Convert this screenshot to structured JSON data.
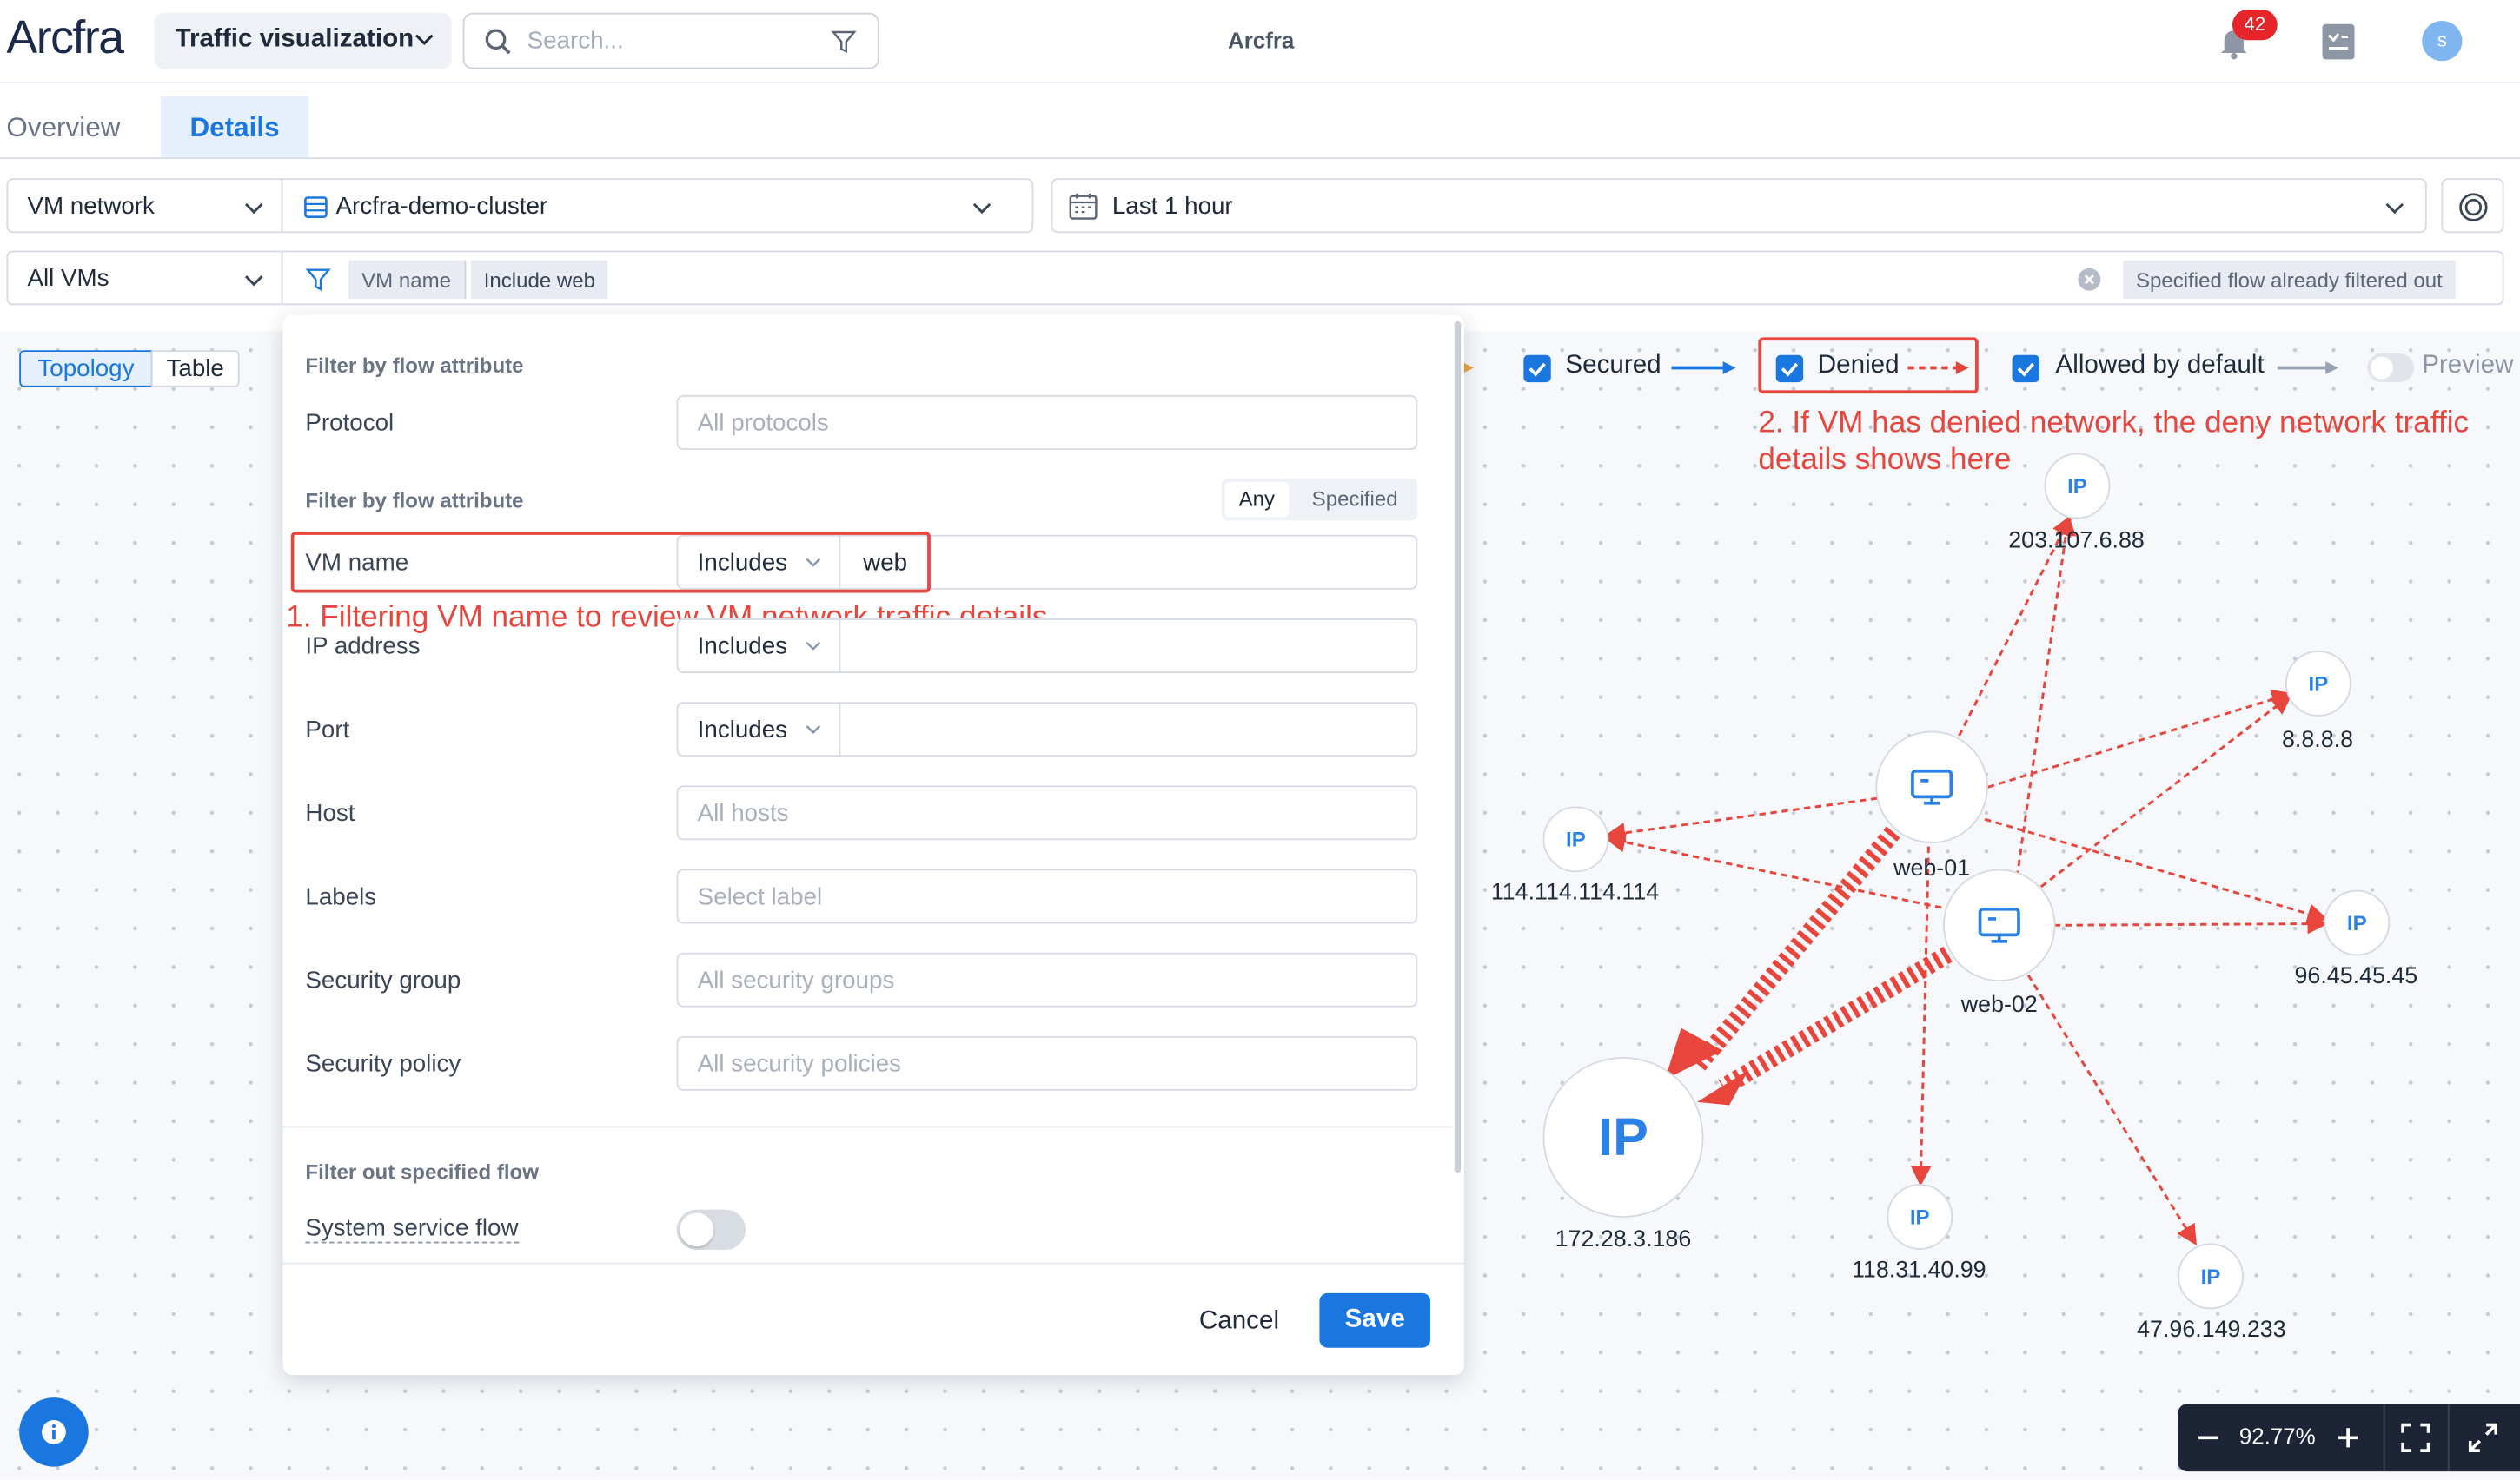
{
  "header": {
    "logo": "Arcfra",
    "app_selector": "Traffic visualization",
    "search_placeholder": "Search...",
    "center_title": "Arcfra",
    "notification_count": "42",
    "avatar_initial": "s"
  },
  "tabs": [
    {
      "label": "Overview",
      "active": false
    },
    {
      "label": "Details",
      "active": true
    }
  ],
  "filters": {
    "view_type": "VM network",
    "cluster": "Arcfra-demo-cluster",
    "time_range": "Last 1 hour",
    "vm_scope": "All VMs",
    "chip_key": "VM name",
    "chip_value": "Include web",
    "filtered_notice": "Specified flow already filtered out"
  },
  "view_toggle": {
    "topology": "Topology",
    "table": "Table"
  },
  "legend": {
    "secured": "Secured",
    "denied": "Denied",
    "allowed_by_default": "Allowed by default",
    "preview": "Preview"
  },
  "annotations": {
    "step1": "1. Filtering VM name to review VM network traffic details",
    "step2_line1": "2. If VM has denied network, the deny network traffic",
    "step2_line2": "details shows here"
  },
  "filter_panel": {
    "section1_title": "Filter by flow attribute",
    "protocol_label": "Protocol",
    "protocol_placeholder": "All protocols",
    "section2_title": "Filter by flow attribute",
    "match_any": "Any",
    "match_specified": "Specified",
    "vm_name_label": "VM name",
    "vm_name_op": "Includes",
    "vm_name_value": "web",
    "ip_label": "IP address",
    "ip_op": "Includes",
    "port_label": "Port",
    "port_op": "Includes",
    "host_label": "Host",
    "host_placeholder": "All hosts",
    "labels_label": "Labels",
    "labels_placeholder": "Select label",
    "sg_label": "Security group",
    "sg_placeholder": "All security groups",
    "sp_label": "Security policy",
    "sp_placeholder": "All security policies",
    "section3_title": "Filter out specified flow",
    "system_flow_label": "System service flow",
    "system_flow_on": false,
    "cancel": "Cancel",
    "save": "Save"
  },
  "topology": {
    "ip_glyph": "IP",
    "vms": [
      "web-01",
      "web-02"
    ],
    "ips": [
      "203.107.6.88",
      "8.8.8.8",
      "114.114.114.114",
      "96.45.45.45",
      "172.28.3.186",
      "118.31.40.99",
      "47.96.149.233"
    ]
  },
  "zoom": {
    "level": "92.77%"
  },
  "colors": {
    "accent": "#1a77e0",
    "denied": "#e8453c",
    "badge": "#e5252a"
  }
}
